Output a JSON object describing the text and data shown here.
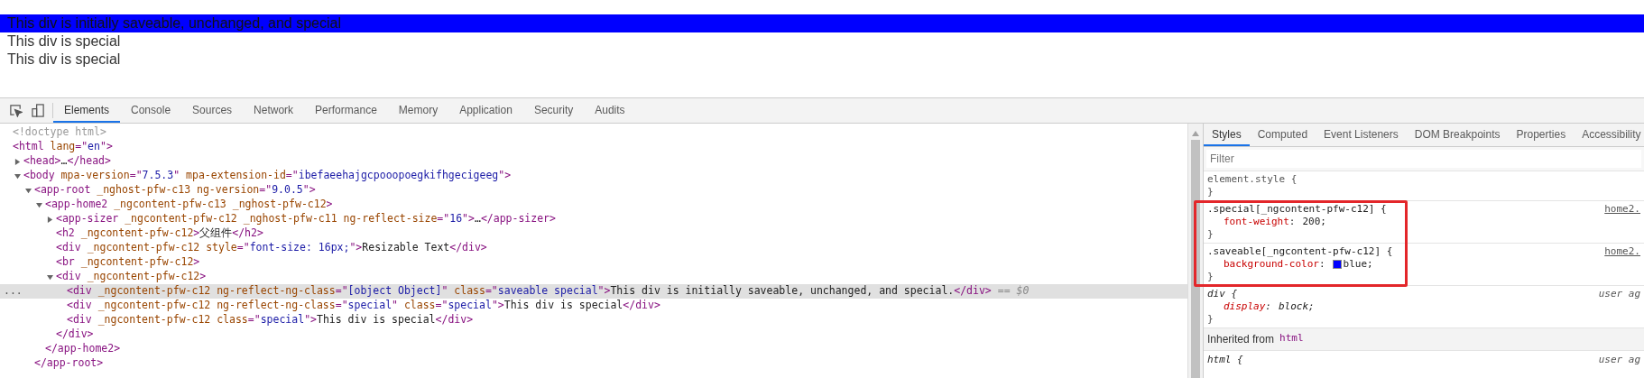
{
  "page": {
    "lines": [
      {
        "text": "This div is initially saveable, unchanged, and special",
        "highlighted": true
      },
      {
        "text": "This div is special",
        "highlighted": false
      },
      {
        "text": "This div is special",
        "highlighted": false
      }
    ]
  },
  "devtools": {
    "tabs": [
      {
        "label": "Elements",
        "selected": true
      },
      {
        "label": "Console",
        "selected": false
      },
      {
        "label": "Sources",
        "selected": false
      },
      {
        "label": "Network",
        "selected": false
      },
      {
        "label": "Performance",
        "selected": false
      },
      {
        "label": "Memory",
        "selected": false
      },
      {
        "label": "Application",
        "selected": false
      },
      {
        "label": "Security",
        "selected": false
      },
      {
        "label": "Audits",
        "selected": false
      }
    ],
    "dom_tree": [
      {
        "tokens": [
          {
            "kind": "comment",
            "text": "<!doctype html>"
          }
        ],
        "selected": false
      },
      {
        "tokens": [
          {
            "kind": "tag",
            "text": "<html "
          },
          {
            "kind": "attr",
            "text": "lang"
          },
          {
            "kind": "tag",
            "text": "=\""
          },
          {
            "kind": "value",
            "text": "en"
          },
          {
            "kind": "tag",
            "text": "\">"
          }
        ],
        "selected": false,
        "children": [
          {
            "tokens": [
              {
                "kind": "tag",
                "text": "<head>"
              },
              {
                "kind": "text",
                "text": "…"
              },
              {
                "kind": "tag",
                "text": "</head>"
              }
            ],
            "expanded": false,
            "selected": false
          },
          {
            "tokens": [
              {
                "kind": "tag",
                "text": "<body "
              },
              {
                "kind": "attr",
                "text": "mpa-version"
              },
              {
                "kind": "tag",
                "text": "=\""
              },
              {
                "kind": "value",
                "text": "7.5.3"
              },
              {
                "kind": "tag",
                "text": "\" "
              },
              {
                "kind": "attr",
                "text": "mpa-extension-id"
              },
              {
                "kind": "tag",
                "text": "=\""
              },
              {
                "kind": "value",
                "text": "ibefaeehajgcpooopoegkifhgecigeeg"
              },
              {
                "kind": "tag",
                "text": "\">"
              }
            ],
            "expanded": true,
            "selected": false,
            "children": [
              {
                "tokens": [
                  {
                    "kind": "tag",
                    "text": "<app-root "
                  },
                  {
                    "kind": "attr",
                    "text": "_nghost-pfw-c13 ng-version"
                  },
                  {
                    "kind": "tag",
                    "text": "=\""
                  },
                  {
                    "kind": "value",
                    "text": "9.0.5"
                  },
                  {
                    "kind": "tag",
                    "text": "\">"
                  }
                ],
                "expanded": true,
                "selected": false,
                "close": "</app-root>",
                "children": [
                  {
                    "tokens": [
                      {
                        "kind": "tag",
                        "text": "<app-home2 "
                      },
                      {
                        "kind": "attr",
                        "text": "_ngcontent-pfw-c13 _nghost-pfw-c12"
                      },
                      {
                        "kind": "tag",
                        "text": ">"
                      }
                    ],
                    "expanded": true,
                    "selected": false,
                    "close": "</app-home2>",
                    "children": [
                      {
                        "tokens": [
                          {
                            "kind": "tag",
                            "text": "<app-sizer "
                          },
                          {
                            "kind": "attr",
                            "text": "_ngcontent-pfw-c12 _nghost-pfw-c11 ng-reflect-size"
                          },
                          {
                            "kind": "tag",
                            "text": "=\""
                          },
                          {
                            "kind": "value",
                            "text": "16"
                          },
                          {
                            "kind": "tag",
                            "text": "\">"
                          },
                          {
                            "kind": "text",
                            "text": "…"
                          },
                          {
                            "kind": "tag",
                            "text": "</app-sizer>"
                          }
                        ],
                        "expanded": false,
                        "selected": false
                      },
                      {
                        "tokens": [
                          {
                            "kind": "tag",
                            "text": "<h2 "
                          },
                          {
                            "kind": "attr",
                            "text": "_ngcontent-pfw-c12"
                          },
                          {
                            "kind": "tag",
                            "text": ">"
                          },
                          {
                            "kind": "text",
                            "text": "父组件"
                          },
                          {
                            "kind": "tag",
                            "text": "</h2>"
                          }
                        ],
                        "selected": false
                      },
                      {
                        "tokens": [
                          {
                            "kind": "tag",
                            "text": "<div "
                          },
                          {
                            "kind": "attr",
                            "text": "_ngcontent-pfw-c12 style"
                          },
                          {
                            "kind": "tag",
                            "text": "=\""
                          },
                          {
                            "kind": "value",
                            "text": "font-size: 16px;"
                          },
                          {
                            "kind": "tag",
                            "text": "\">"
                          },
                          {
                            "kind": "text",
                            "text": "Resizable Text"
                          },
                          {
                            "kind": "tag",
                            "text": "</div>"
                          }
                        ],
                        "selected": false
                      },
                      {
                        "tokens": [
                          {
                            "kind": "tag",
                            "text": "<br "
                          },
                          {
                            "kind": "attr",
                            "text": "_ngcontent-pfw-c12"
                          },
                          {
                            "kind": "tag",
                            "text": ">"
                          }
                        ],
                        "selected": false
                      },
                      {
                        "tokens": [
                          {
                            "kind": "tag",
                            "text": "<div "
                          },
                          {
                            "kind": "attr",
                            "text": "_ngcontent-pfw-c12"
                          },
                          {
                            "kind": "tag",
                            "text": ">"
                          }
                        ],
                        "expanded": true,
                        "selected": false,
                        "close": "</div>",
                        "children": [
                          {
                            "gutter": "...",
                            "tokens": [
                              {
                                "kind": "tag",
                                "text": "<div "
                              },
                              {
                                "kind": "attr",
                                "text": "_ngcontent-pfw-c12 ng-reflect-ng-class"
                              },
                              {
                                "kind": "tag",
                                "text": "=\""
                              },
                              {
                                "kind": "value",
                                "text": "[object Object]"
                              },
                              {
                                "kind": "tag",
                                "text": "\" "
                              },
                              {
                                "kind": "attr",
                                "text": "class"
                              },
                              {
                                "kind": "tag",
                                "text": "=\""
                              },
                              {
                                "kind": "value",
                                "text": "saveable special"
                              },
                              {
                                "kind": "tag",
                                "text": "\">"
                              },
                              {
                                "kind": "text",
                                "text": "This div is initially saveable, unchanged, and special."
                              },
                              {
                                "kind": "tag",
                                "text": "</div>"
                              },
                              {
                                "kind": "hint",
                                "text": " == $0"
                              }
                            ],
                            "selected": true
                          },
                          {
                            "tokens": [
                              {
                                "kind": "tag",
                                "text": "<div "
                              },
                              {
                                "kind": "attr",
                                "text": "_ngcontent-pfw-c12 ng-reflect-ng-class"
                              },
                              {
                                "kind": "tag",
                                "text": "=\""
                              },
                              {
                                "kind": "value",
                                "text": "special"
                              },
                              {
                                "kind": "tag",
                                "text": "\" "
                              },
                              {
                                "kind": "attr",
                                "text": "class"
                              },
                              {
                                "kind": "tag",
                                "text": "=\""
                              },
                              {
                                "kind": "value",
                                "text": "special"
                              },
                              {
                                "kind": "tag",
                                "text": "\">"
                              },
                              {
                                "kind": "text",
                                "text": "This div is special"
                              },
                              {
                                "kind": "tag",
                                "text": "</div>"
                              }
                            ],
                            "selected": false
                          },
                          {
                            "tokens": [
                              {
                                "kind": "tag",
                                "text": "<div "
                              },
                              {
                                "kind": "attr",
                                "text": "_ngcontent-pfw-c12 class"
                              },
                              {
                                "kind": "tag",
                                "text": "=\""
                              },
                              {
                                "kind": "value",
                                "text": "special"
                              },
                              {
                                "kind": "tag",
                                "text": "\">"
                              },
                              {
                                "kind": "text",
                                "text": "This div is special"
                              },
                              {
                                "kind": "tag",
                                "text": "</div>"
                              }
                            ],
                            "selected": false
                          }
                        ]
                      }
                    ]
                  }
                ]
              }
            ]
          }
        ]
      }
    ],
    "sidebar": {
      "tabs": [
        {
          "label": "Styles",
          "selected": true
        },
        {
          "label": "Computed",
          "selected": false
        },
        {
          "label": "Event Listeners",
          "selected": false
        },
        {
          "label": "DOM Breakpoints",
          "selected": false
        },
        {
          "label": "Properties",
          "selected": false
        },
        {
          "label": "Accessibility",
          "selected": false
        }
      ],
      "filter": {
        "placeholder": "Filter"
      },
      "rules": [
        {
          "kind": "inline",
          "selector": "element.style {",
          "close": "}",
          "highlighted": false
        },
        {
          "kind": "author",
          "selector": ".special[_ngcontent-pfw-c12] {",
          "source": "home2.",
          "close": "}",
          "highlighted": true,
          "declarations": [
            {
              "property": "font-weight",
              "separator": ":",
              "value": "200;"
            }
          ]
        },
        {
          "kind": "author",
          "selector": ".saveable[_ngcontent-pfw-c12] {",
          "source": "home2.",
          "close": "}",
          "highlighted": true,
          "declarations": [
            {
              "property": "background-color",
              "separator": ":",
              "value": "blue;",
              "color": "#0000ff"
            }
          ]
        },
        {
          "kind": "user-agent",
          "selector": "div {",
          "source": "user ag",
          "close": "}",
          "highlighted": false,
          "declarations": [
            {
              "property": "display",
              "separator": ":",
              "value": "block;"
            }
          ]
        }
      ],
      "inherited": {
        "label": "Inherited from",
        "element": "html"
      },
      "inherited_rule": {
        "kind": "user-agent",
        "selector": "html {",
        "source": "user ag"
      }
    }
  }
}
